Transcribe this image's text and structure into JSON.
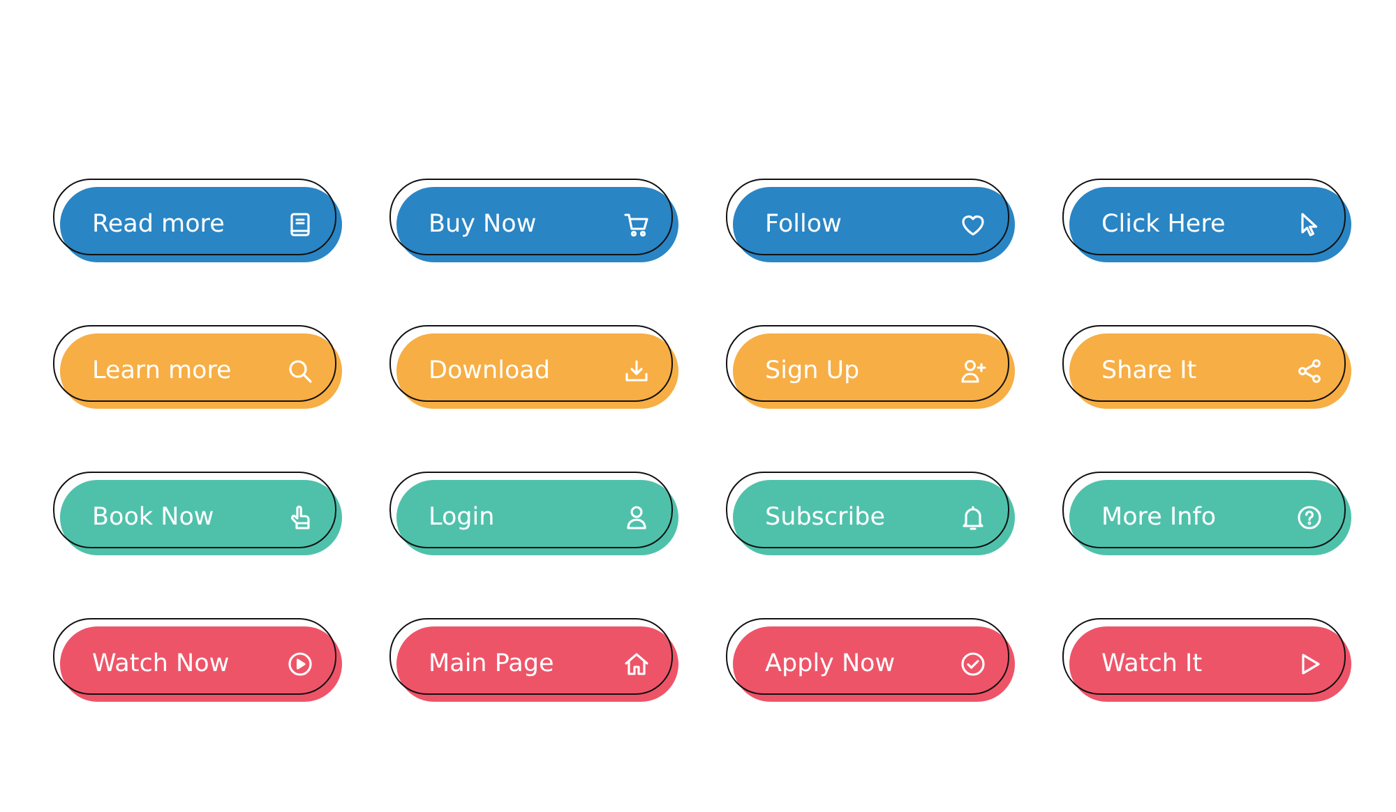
{
  "buttons": [
    {
      "label": "Read more",
      "color": "#2a85c4"
    },
    {
      "label": "Buy Now",
      "color": "#2a85c4"
    },
    {
      "label": "Follow",
      "color": "#2a85c4"
    },
    {
      "label": "Click Here",
      "color": "#2a85c4"
    },
    {
      "label": "Learn more",
      "color": "#f7ae44"
    },
    {
      "label": "Download",
      "color": "#f7ae44"
    },
    {
      "label": "Sign Up",
      "color": "#f7ae44"
    },
    {
      "label": "Share It",
      "color": "#f7ae44"
    },
    {
      "label": "Book Now",
      "color": "#4fc1ab"
    },
    {
      "label": "Login",
      "color": "#4fc1ab"
    },
    {
      "label": "Subscribe",
      "color": "#4fc1ab"
    },
    {
      "label": "More Info",
      "color": "#4fc1ab"
    },
    {
      "label": "Watch Now",
      "color": "#ee5468"
    },
    {
      "label": "Main Page",
      "color": "#ee5468"
    },
    {
      "label": "Apply Now",
      "color": "#ee5468"
    },
    {
      "label": "Watch It",
      "color": "#ee5468"
    }
  ]
}
